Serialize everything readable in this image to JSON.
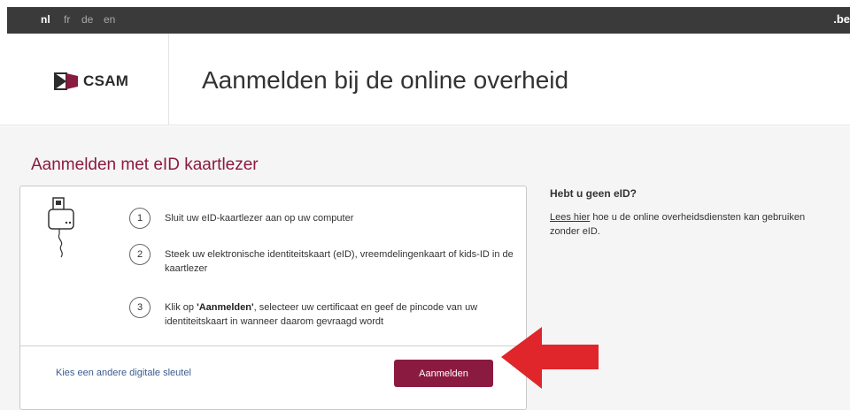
{
  "topbar": {
    "languages": [
      "nl",
      "fr",
      "de",
      "en"
    ],
    "active_language": "nl",
    "domain": ".be"
  },
  "header": {
    "logo_text": "CSAM",
    "title": "Aanmelden bij de online overheid"
  },
  "main": {
    "section_title": "Aanmelden met eID kaartlezer",
    "steps": [
      {
        "number": "1",
        "text": "Sluit uw eID-kaartlezer aan op uw computer"
      },
      {
        "number": "2",
        "text": "Steek uw elektronische identiteitskaart (eID), vreemdelingenkaart of kids-ID in de kaartlezer"
      },
      {
        "number": "3",
        "text_bold": "'Aanmelden'",
        "text_before": "Klik op ",
        "text_after": ", selecteer uw certificaat en geef de pincode van uw identiteitskaart in wanneer daarom gevraagd wordt"
      }
    ],
    "alt_key_link": "Kies een andere digitale sleutel",
    "login_button": "Aanmelden"
  },
  "sidebar": {
    "title": "Hebt u geen eID?",
    "link_text": "Lees hier",
    "text": " hoe u de online overheidsdiensten kan gebruiken zonder eID."
  },
  "colors": {
    "accent": "#8b1a40",
    "topbar": "#3a3a3a",
    "arrow": "#e0262a",
    "link": "#3a5c8e"
  },
  "icons": [
    "card-reader-icon",
    "csam-logo-icon",
    "red-arrow-icon"
  ]
}
